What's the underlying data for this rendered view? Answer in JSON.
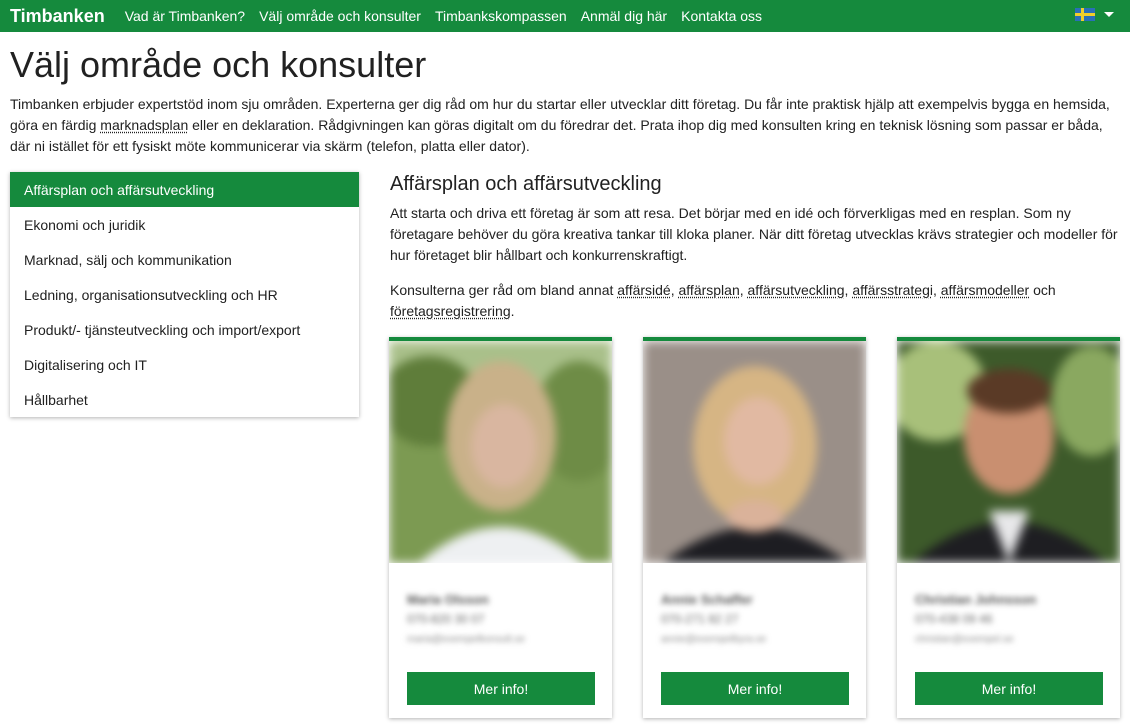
{
  "navbar": {
    "brand": "Timbanken",
    "links": [
      "Vad är Timbanken?",
      "Välj område och konsulter",
      "Timbankskompassen",
      "Anmäl dig här",
      "Kontakta oss"
    ],
    "language_flag": "swedish-flag-icon"
  },
  "page": {
    "title": "Välj område och konsulter",
    "intro_part1": "Timbanken erbjuder expertstöd inom sju områden. Experterna ger dig råd om hur du startar eller utvecklar ditt företag. Du får inte praktisk hjälp att exempelvis bygga en hemsida, göra en färdig ",
    "intro_link": "marknadsplan",
    "intro_part2": " eller en deklaration. Rådgivningen kan göras digitalt om du föredrar det. Prata ihop dig med konsulten kring en teknisk lösning som passar er båda, där ni istället för ett fysiskt möte kommunicerar via skärm (telefon, platta eller dator)."
  },
  "sidebar": {
    "items": [
      {
        "label": "Affärsplan och affärsutveckling",
        "active": true
      },
      {
        "label": "Ekonomi och juridik"
      },
      {
        "label": "Marknad, sälj och kommunikation"
      },
      {
        "label": "Ledning, organisationsutveckling och HR"
      },
      {
        "label": "Produkt/- tjänsteutveckling och import/export"
      },
      {
        "label": "Digitalisering och IT"
      },
      {
        "label": "Hållbarhet"
      }
    ]
  },
  "section": {
    "title": "Affärsplan och affärsutveckling",
    "description": "Att starta och driva ett företag är som att resa. Det börjar med en idé och förverkligas med en resplan. Som ny företagare behöver du göra kreativa tankar till kloka planer. När ditt företag utvecklas krävs strategier och modeller för hur företaget blir hållbart och konkurrenskraftigt.",
    "advice_prefix": "Konsulterna ger råd om bland annat ",
    "topics": [
      "affärsidé",
      "affärsplan",
      "affärsutveckling",
      "affärsstrategi",
      "affärsmodeller",
      "företagsregistrering"
    ],
    "advice_and": " och ",
    "advice_suffix": "."
  },
  "consultants": [
    {
      "name": "Maria Olsson",
      "phone": "070-820 30 07",
      "email": "maria@exempelkonsult.se",
      "button_label": "Mer info!"
    },
    {
      "name": "Annie Schaffer",
      "phone": "070-271 82 27",
      "email": "annie@exempelbyra.se",
      "button_label": "Mer info!"
    },
    {
      "name": "Christian Johnsson",
      "phone": "070-438 09 46",
      "email": "christian@exempel.se",
      "button_label": "Mer info!"
    }
  ],
  "colors": {
    "brand_green": "#158a3d",
    "text": "#212121"
  }
}
